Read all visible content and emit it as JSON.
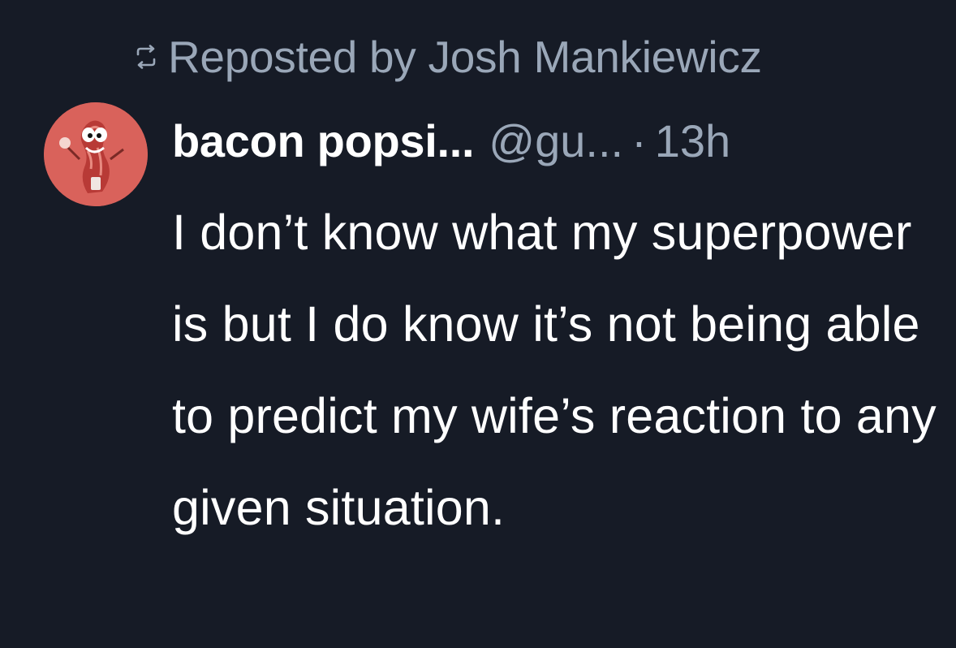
{
  "repost": {
    "icon": "repost-icon",
    "text": "Reposted by Josh Mankiewicz"
  },
  "post": {
    "avatar_icon": "bacon-mascot-avatar",
    "display_name": "bacon popsi...",
    "handle": "@gu...",
    "separator": "·",
    "timestamp": "13h",
    "text": "I don’t know what my superpower is but I do know it’s not being able to predict my wife’s reaction to any given situation."
  },
  "colors": {
    "background": "#161b26",
    "muted_text": "#9aa7b8",
    "primary_text": "#ffffff",
    "avatar_bg": "#d9625b"
  }
}
